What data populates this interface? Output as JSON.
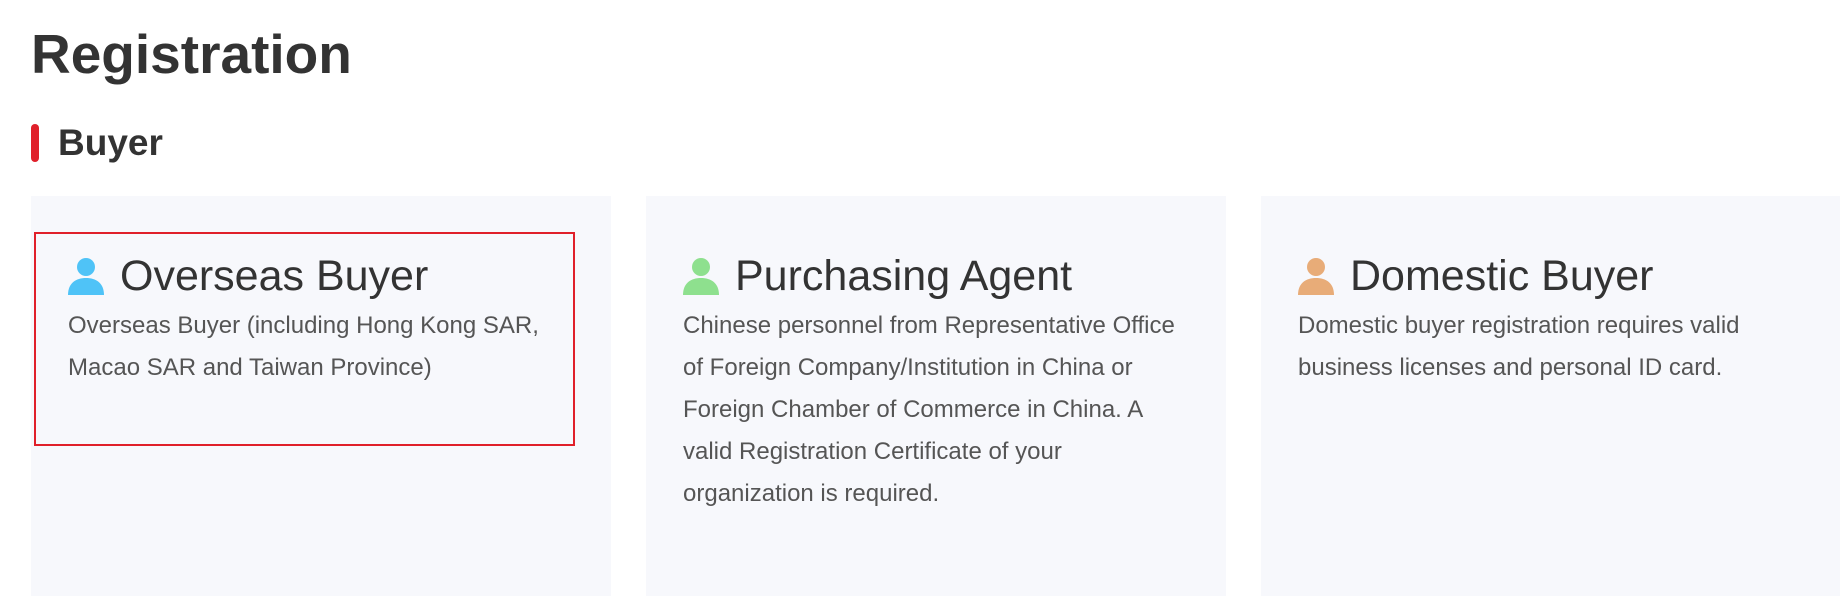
{
  "page": {
    "title": "Registration"
  },
  "section": {
    "title": "Buyer",
    "accent_color": "#e0202a"
  },
  "cards": [
    {
      "title": "Overseas Buyer",
      "icon": "person-icon",
      "icon_color": "#4fc3f7",
      "description": "Overseas Buyer (including Hong Kong SAR, Macao SAR and Taiwan Province)",
      "selected": true
    },
    {
      "title": "Purchasing Agent",
      "icon": "person-icon",
      "icon_color": "#8ee08e",
      "description": "Chinese personnel from Representative Office of Foreign Company/Institution in China or Foreign Chamber of Commerce in China. A valid Registration Certificate of your organization is required.",
      "selected": false
    },
    {
      "title": "Domestic Buyer",
      "icon": "person-icon",
      "icon_color": "#e8ac78",
      "description": "Domestic buyer registration requires valid business licenses and personal ID card.",
      "selected": false
    }
  ],
  "colors": {
    "card_background": "#f7f8fc",
    "selection_border": "#e0202a",
    "title_text": "#333333",
    "body_text": "#555555"
  }
}
